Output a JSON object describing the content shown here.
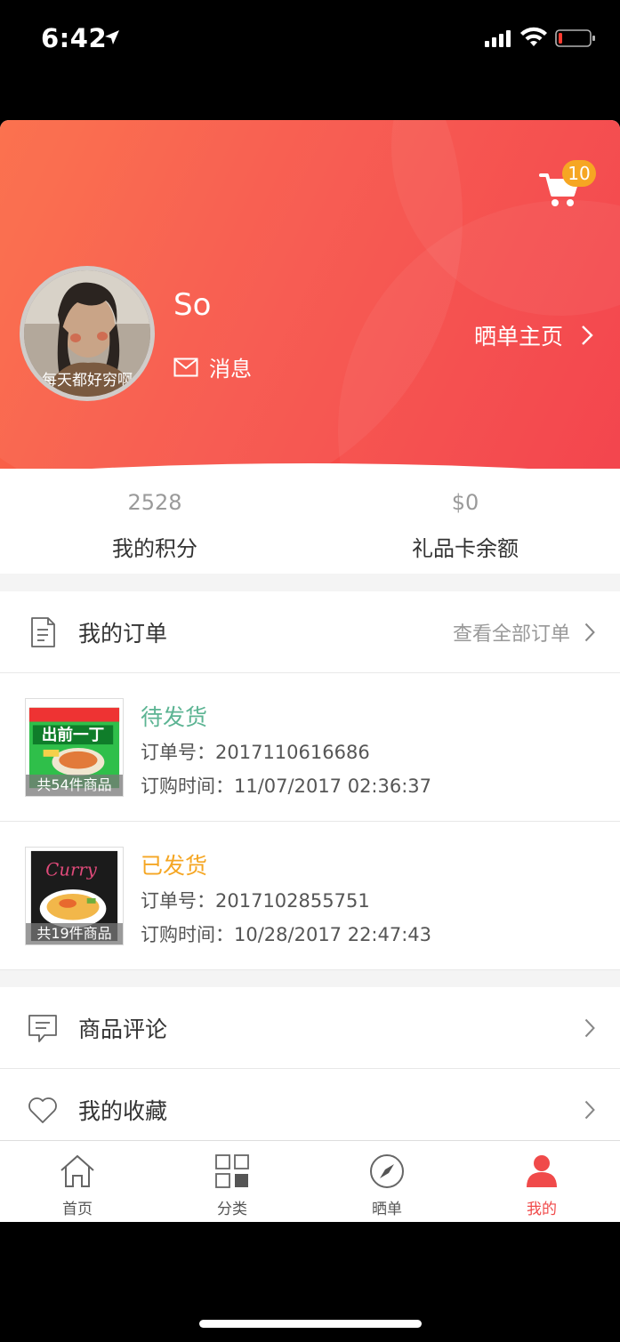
{
  "status_bar": {
    "time": "6:42"
  },
  "header": {
    "cart_badge": "10",
    "username": "So",
    "message_label": "消息",
    "show_home_label": "晒单主页",
    "avatar_caption": "每天都好穷啊"
  },
  "stats": [
    {
      "value": "2528",
      "label": "我的积分"
    },
    {
      "value": "$0",
      "label": "礼品卡余额"
    }
  ],
  "orders_section": {
    "title": "我的订单",
    "view_all": "查看全部订单"
  },
  "orders": [
    {
      "status": "待发货",
      "status_color": "#5cb493",
      "order_no": "订单号：2017110616686",
      "time": "订购时间：11/07/2017 02:36:37",
      "thumb_caption": "共54件商品",
      "thumb_brand": "出前一丁"
    },
    {
      "status": "已发货",
      "status_color": "#f5a623",
      "order_no": "订单号：2017102855751",
      "time": "订购时间：10/28/2017 22:47:43",
      "thumb_caption": "共19件商品",
      "thumb_brand": "Curry"
    }
  ],
  "menu": [
    {
      "label": "商品评论",
      "icon": "comment-icon"
    },
    {
      "label": "我的收藏",
      "icon": "heart-icon"
    }
  ],
  "tabbar": [
    {
      "label": "首页",
      "icon": "home-icon",
      "active": false
    },
    {
      "label": "分类",
      "icon": "category-icon",
      "active": false
    },
    {
      "label": "晒单",
      "icon": "compass-icon",
      "active": false
    },
    {
      "label": "我的",
      "icon": "user-icon",
      "active": true
    }
  ],
  "colors": {
    "brand_red": "#f04a4a",
    "header_gradient_start": "#fb6a45",
    "header_gradient_end": "#f33c45",
    "badge": "#f6a623"
  }
}
